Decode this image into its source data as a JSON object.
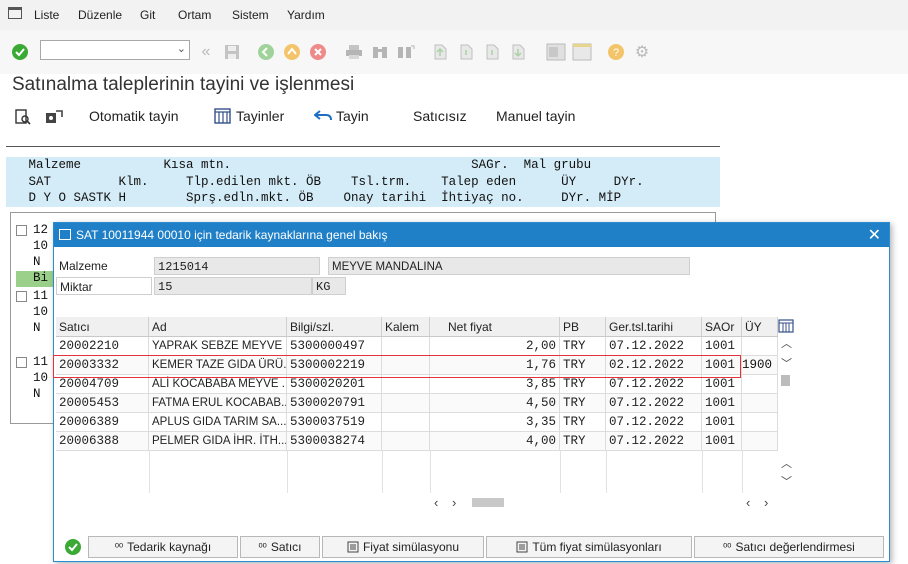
{
  "menu": {
    "items": [
      {
        "label": "Liste"
      },
      {
        "label": "Düzenle"
      },
      {
        "label": "Git"
      },
      {
        "label": "Ortam"
      },
      {
        "label": "Sistem"
      },
      {
        "label": "Yardım"
      }
    ]
  },
  "toolbar": {
    "command_field_value": "",
    "icons": [
      "enter-icon",
      "back-icon",
      "save-icon",
      "back-nav-icon",
      "exit-icon",
      "cancel-icon",
      "print-icon",
      "find-icon",
      "find-next-icon",
      "first-page-icon",
      "prev-page-icon",
      "next-page-icon",
      "last-page-icon",
      "layout-icon",
      "help-icon",
      "settings-icon"
    ]
  },
  "screen": {
    "title": "Satınalma taleplerinin tayini ve işlenmesi"
  },
  "app_toolbar": {
    "buttons": [
      {
        "label": "Otomatik tayin"
      },
      {
        "label": "Tayinler"
      },
      {
        "label": "Tayin"
      },
      {
        "label": "Satıcısız"
      },
      {
        "label": "Manuel tayin"
      }
    ]
  },
  "list_header": {
    "row1": "   Malzeme           Kısa mtn.                                SAGr.  Mal grubu",
    "row2": "   SAT         Klm.     Tlp.edilen mkt. ÖB    Tsl.trm.    Talep eden      ÜY     DYr.",
    "row3": "   D Y O SASTK H        Sprş.edln.mkt. ÖB    Onay tarihi  İhtiyaç no.     DYr. MİP"
  },
  "background_list": {
    "lines": [
      "12",
      "10",
      "N",
      "Bi",
      "11",
      "10",
      "N",
      "11",
      "10",
      "N"
    ]
  },
  "dialog": {
    "title": "SAT 10011944 00010 için tedarik kaynaklarına genel bakış",
    "material_label": "Malzeme",
    "material_value": "1215014",
    "material_desc": "MEYVE MANDALINA",
    "quantity_label": "Miktar",
    "quantity_value": "15",
    "unit_value": "KG",
    "columns": [
      "Satıcı",
      "Ad",
      "Bilgi/szl.",
      "Kalem",
      "Net fiyat",
      "PB",
      "Ger.tsl.tarihi",
      "SAOr",
      "ÜY"
    ],
    "rows": [
      {
        "vendor": "20002210",
        "name": "YAPRAK SEBZE MEYVE ...",
        "info": "5300000497",
        "item": "",
        "price": "2,00",
        "currency": "TRY",
        "date": "07.12.2022",
        "org": "1001"
      },
      {
        "vendor": "20003332",
        "name": "KEMER TAZE GIDA ÜRÜ...",
        "info": "5300002219",
        "item": "",
        "price": "1,76",
        "currency": "TRY",
        "date": "02.12.2022",
        "org": "1001"
      },
      {
        "vendor": "20004709",
        "name": "ALİ KOCABABA MEYVE ...",
        "info": "5300020201",
        "item": "",
        "price": "3,85",
        "currency": "TRY",
        "date": "07.12.2022",
        "org": "1001"
      },
      {
        "vendor": "20005453",
        "name": "FATMA ERUL KOCABAB...",
        "info": "5300020791",
        "item": "",
        "price": "4,50",
        "currency": "TRY",
        "date": "07.12.2022",
        "org": "1001"
      },
      {
        "vendor": "20006389",
        "name": "APLUS GIDA TARIM SA...",
        "info": "5300037519",
        "item": "",
        "price": "3,35",
        "currency": "TRY",
        "date": "07.12.2022",
        "org": "1001"
      },
      {
        "vendor": "20006388",
        "name": "PELMER GIDA İHR. İTH...",
        "info": "5300038274",
        "item": "",
        "price": "4,00",
        "currency": "TRY",
        "date": "07.12.2022",
        "org": "1001"
      }
    ],
    "overflow_value": "1900",
    "footer_buttons": [
      {
        "label": "Tedarik kaynağı"
      },
      {
        "label": "Satıcı"
      },
      {
        "label": "Fiyat simülasyonu"
      },
      {
        "label": "Tüm fiyat simülasyonları"
      },
      {
        "label": "Satıcı değerlendirmesi"
      }
    ]
  },
  "colors": {
    "dialog_title_bg": "#1f7fc7",
    "header_bg": "#d4ecf7",
    "highlight_border": "#e0343a",
    "enter_green": "#3aaa35"
  }
}
